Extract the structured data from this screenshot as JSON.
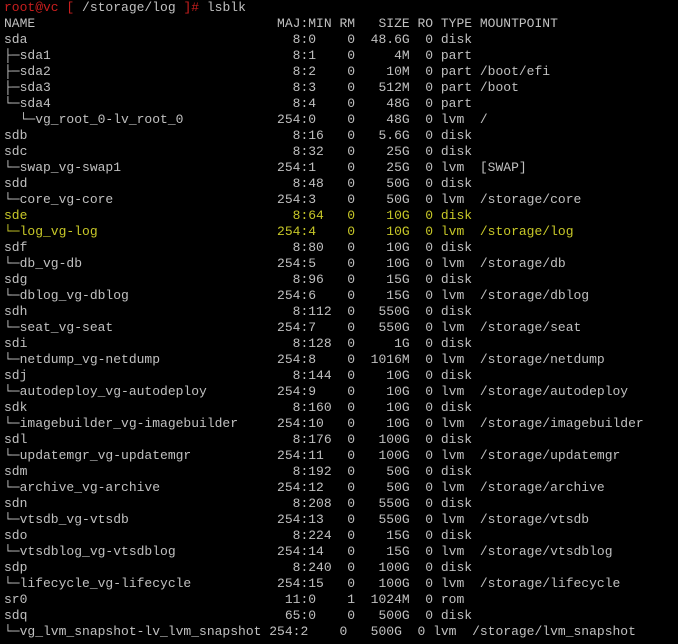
{
  "colors": {
    "background": "#000000",
    "text": "#c0c0c0",
    "prompt": "#c81e1e",
    "highlight": "#c8c828"
  },
  "prompt": {
    "user_host": "root@vc",
    "open_bracket": " [ ",
    "path": "/storage/log",
    "close_bracket": " ]",
    "hash": "#",
    "command": " lsblk"
  },
  "rows": [
    {
      "text": "NAME                               MAJ:MIN RM   SIZE RO TYPE MOUNTPOINT",
      "highlight": false
    },
    {
      "text": "sda                                  8:0    0  48.6G  0 disk",
      "highlight": false
    },
    {
      "text": "├─sda1                               8:1    0     4M  0 part",
      "highlight": false
    },
    {
      "text": "├─sda2                               8:2    0    10M  0 part /boot/efi",
      "highlight": false
    },
    {
      "text": "├─sda3                               8:3    0   512M  0 part /boot",
      "highlight": false
    },
    {
      "text": "└─sda4                               8:4    0    48G  0 part",
      "highlight": false
    },
    {
      "text": "  └─vg_root_0-lv_root_0            254:0    0    48G  0 lvm  /",
      "highlight": false
    },
    {
      "text": "sdb                                  8:16   0   5.6G  0 disk",
      "highlight": false
    },
    {
      "text": "sdc                                  8:32   0    25G  0 disk",
      "highlight": false
    },
    {
      "text": "└─swap_vg-swap1                    254:1    0    25G  0 lvm  [SWAP]",
      "highlight": false
    },
    {
      "text": "sdd                                  8:48   0    50G  0 disk",
      "highlight": false
    },
    {
      "text": "└─core_vg-core                     254:3    0    50G  0 lvm  /storage/core",
      "highlight": false
    },
    {
      "text": "sde                                  8:64   0    10G  0 disk",
      "highlight": true
    },
    {
      "text": "└─log_vg-log                       254:4    0    10G  0 lvm  /storage/log",
      "highlight": true
    },
    {
      "text": "sdf                                  8:80   0    10G  0 disk",
      "highlight": false
    },
    {
      "text": "└─db_vg-db                         254:5    0    10G  0 lvm  /storage/db",
      "highlight": false
    },
    {
      "text": "sdg                                  8:96   0    15G  0 disk",
      "highlight": false
    },
    {
      "text": "└─dblog_vg-dblog                   254:6    0    15G  0 lvm  /storage/dblog",
      "highlight": false
    },
    {
      "text": "sdh                                  8:112  0   550G  0 disk",
      "highlight": false
    },
    {
      "text": "└─seat_vg-seat                     254:7    0   550G  0 lvm  /storage/seat",
      "highlight": false
    },
    {
      "text": "sdi                                  8:128  0     1G  0 disk",
      "highlight": false
    },
    {
      "text": "└─netdump_vg-netdump               254:8    0  1016M  0 lvm  /storage/netdump",
      "highlight": false
    },
    {
      "text": "sdj                                  8:144  0    10G  0 disk",
      "highlight": false
    },
    {
      "text": "└─autodeploy_vg-autodeploy         254:9    0    10G  0 lvm  /storage/autodeploy",
      "highlight": false
    },
    {
      "text": "sdk                                  8:160  0    10G  0 disk",
      "highlight": false
    },
    {
      "text": "└─imagebuilder_vg-imagebuilder     254:10   0    10G  0 lvm  /storage/imagebuilder",
      "highlight": false
    },
    {
      "text": "sdl                                  8:176  0   100G  0 disk",
      "highlight": false
    },
    {
      "text": "└─updatemgr_vg-updatemgr           254:11   0   100G  0 lvm  /storage/updatemgr",
      "highlight": false
    },
    {
      "text": "sdm                                  8:192  0    50G  0 disk",
      "highlight": false
    },
    {
      "text": "└─archive_vg-archive               254:12   0    50G  0 lvm  /storage/archive",
      "highlight": false
    },
    {
      "text": "sdn                                  8:208  0   550G  0 disk",
      "highlight": false
    },
    {
      "text": "└─vtsdb_vg-vtsdb                   254:13   0   550G  0 lvm  /storage/vtsdb",
      "highlight": false
    },
    {
      "text": "sdo                                  8:224  0    15G  0 disk",
      "highlight": false
    },
    {
      "text": "└─vtsdblog_vg-vtsdblog             254:14   0    15G  0 lvm  /storage/vtsdblog",
      "highlight": false
    },
    {
      "text": "sdp                                  8:240  0   100G  0 disk",
      "highlight": false
    },
    {
      "text": "└─lifecycle_vg-lifecycle           254:15   0   100G  0 lvm  /storage/lifecycle",
      "highlight": false
    },
    {
      "text": "sr0                                 11:0    1  1024M  0 rom",
      "highlight": false
    },
    {
      "text": "sdq                                 65:0    0   500G  0 disk",
      "highlight": false
    },
    {
      "text": "└─vg_lvm_snapshot-lv_lvm_snapshot 254:2    0   500G  0 lvm  /storage/lvm_snapshot",
      "highlight": false
    }
  ]
}
